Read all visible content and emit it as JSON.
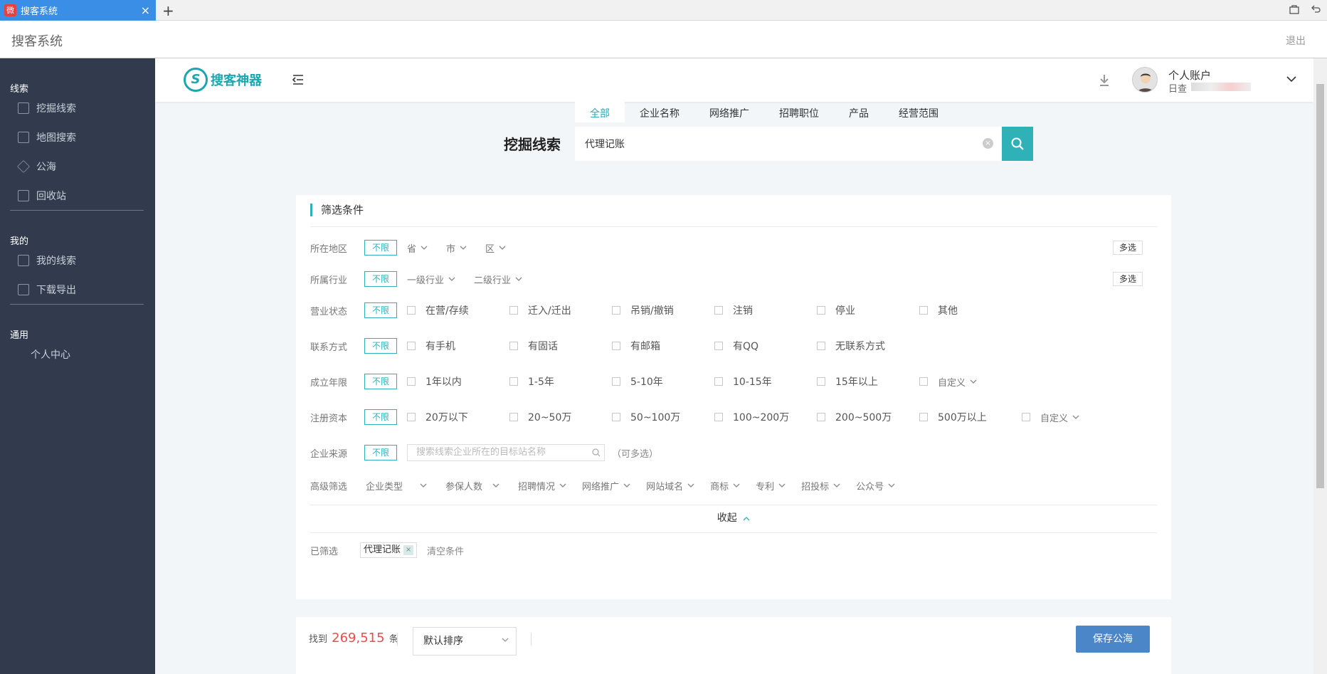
{
  "browser": {
    "tab_title": "搜客系统",
    "tab_favicon": "微",
    "new_tab": "+"
  },
  "apphead": {
    "title": "搜客系统",
    "logout": "退出"
  },
  "sidebar": {
    "group1": "线索",
    "items1": [
      "挖掘线索",
      "地图搜索",
      "公海",
      "回收站"
    ],
    "group2": "我的",
    "items2": [
      "我的线索",
      "下载导出"
    ],
    "group3": "通用",
    "items3": [
      "个人中心"
    ]
  },
  "topnav": {
    "logo_text": "搜客神器",
    "logo_mark": "S",
    "account_name": "个人账户",
    "account_sub": "日查"
  },
  "search": {
    "tabs": [
      "全部",
      "企业名称",
      "网络推广",
      "招聘职位",
      "产品",
      "经营范围"
    ],
    "label": "挖掘线索",
    "value": "代理记账"
  },
  "filter": {
    "title": "筛选条件",
    "no_limit": "不限",
    "multi": "多选",
    "region": {
      "label": "所在地区",
      "dropdowns": [
        "省",
        "市",
        "区"
      ]
    },
    "industry": {
      "label": "所属行业",
      "dropdowns": [
        "一级行业",
        "二级行业"
      ]
    },
    "status": {
      "label": "营业状态",
      "options": [
        "在营/存续",
        "迁入/迁出",
        "吊销/撤销",
        "注销",
        "停业",
        "其他"
      ]
    },
    "contact": {
      "label": "联系方式",
      "options": [
        "有手机",
        "有固话",
        "有邮箱",
        "有QQ",
        "无联系方式"
      ]
    },
    "years": {
      "label": "成立年限",
      "options": [
        "1年以内",
        "1-5年",
        "5-10年",
        "10-15年",
        "15年以上"
      ],
      "custom": "自定义"
    },
    "capital": {
      "label": "注册资本",
      "options": [
        "20万以下",
        "20~50万",
        "50~100万",
        "100~200万",
        "200~500万",
        "500万以上"
      ],
      "custom": "自定义"
    },
    "source": {
      "label": "企业来源",
      "placeholder": "搜索线索企业所在的目标站名称",
      "hint": "（可多选）"
    },
    "advanced": {
      "label": "高级筛选",
      "dropdowns": [
        "企业类型",
        "参保人数",
        "招聘情况",
        "网络推广",
        "网站域名",
        "商标",
        "专利",
        "招投标",
        "公众号"
      ]
    },
    "collapse": "收起",
    "selected": {
      "label": "已筛选",
      "chips": [
        "代理记账"
      ],
      "clear": "清空条件"
    }
  },
  "results": {
    "found_prefix": "找到",
    "count": "269,515",
    "found_suffix": "条",
    "sort": "默认排序",
    "save": "保存公海"
  },
  "colors": {
    "accent": "#2fb2b7",
    "sidebar": "#313b4d",
    "save_button": "#4a86c8",
    "count": "#e84d4d"
  }
}
